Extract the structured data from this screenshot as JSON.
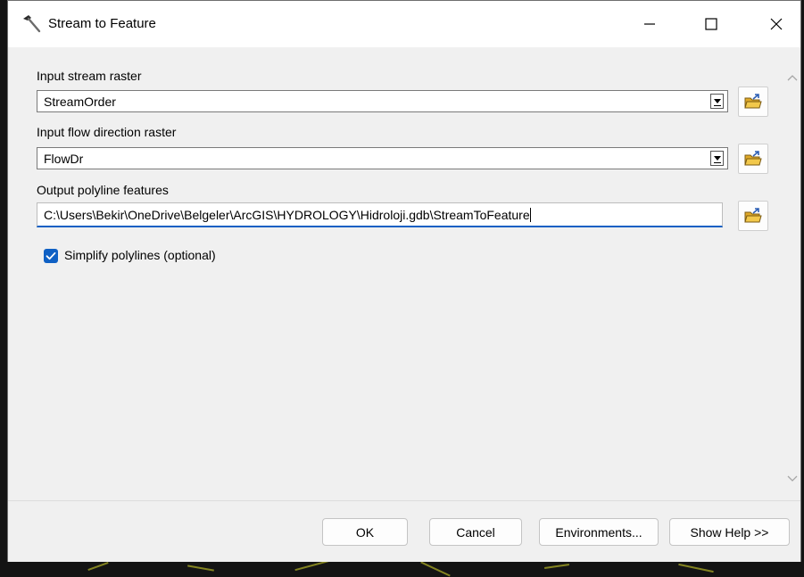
{
  "window": {
    "title": "Stream to Feature",
    "controls": {
      "minimize": "minimize",
      "maximize": "maximize",
      "close": "close"
    }
  },
  "fields": {
    "input_stream_raster": {
      "label": "Input stream raster",
      "value": "StreamOrder"
    },
    "input_flow_direction_raster": {
      "label": "Input flow direction raster",
      "value": "FlowDr"
    },
    "output_polyline_features": {
      "label": "Output polyline features",
      "value": "C:\\Users\\Bekir\\OneDrive\\Belgeler\\ArcGIS\\HYDROLOGY\\Hidroloji.gdb\\StreamToFeature"
    }
  },
  "options": {
    "simplify_polylines": {
      "label": "Simplify polylines (optional)",
      "checked": true
    }
  },
  "footer": {
    "ok": "OK",
    "cancel": "Cancel",
    "environments": "Environments...",
    "show_help": "Show Help >>"
  },
  "colors": {
    "accent": "#0f60c4",
    "dialog_background": "#f0f0f0",
    "titlebar_background": "#ffffff",
    "folder_icon": "#f2c84b"
  },
  "icons": {
    "app": "hammer-icon",
    "browse": "folder-open-icon",
    "dropdown": "chevron-down-icon",
    "scroll_up": "chevron-up-icon",
    "scroll_down": "chevron-down-icon",
    "check": "checkmark-icon"
  }
}
